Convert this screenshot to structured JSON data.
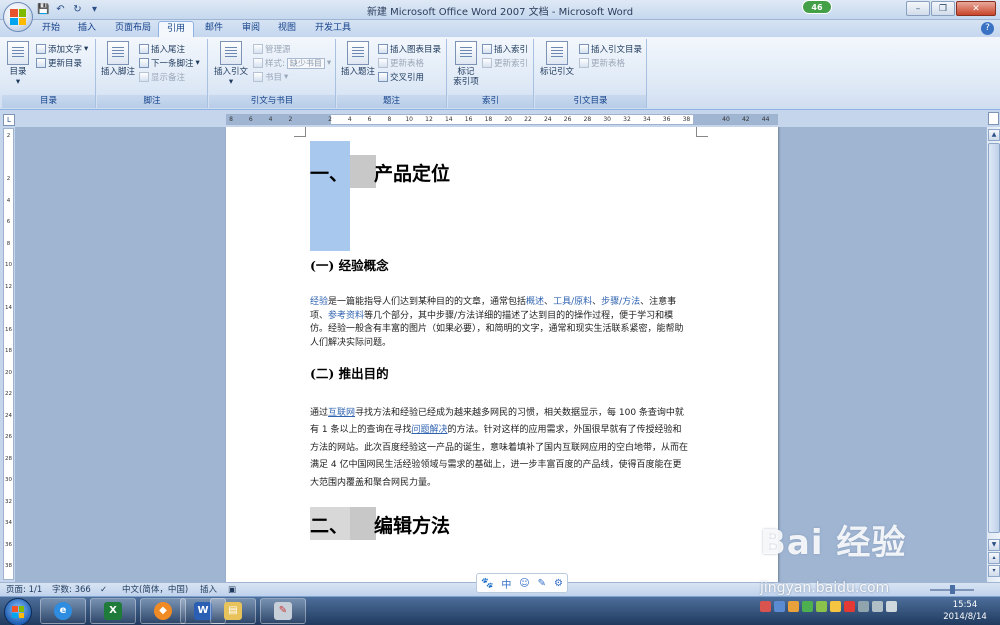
{
  "window": {
    "title": "新建 Microsoft Office Word 2007 文档 - Microsoft Word",
    "badge": "46",
    "minimize": "–",
    "restore": "❐",
    "close": "✕"
  },
  "tabs": [
    "开始",
    "插入",
    "页面布局",
    "引用",
    "邮件",
    "审阅",
    "视图",
    "开发工具"
  ],
  "active_tab": "引用",
  "ribbon": {
    "toc": {
      "big": "目录",
      "add_text": "添加文字",
      "update": "更新目录",
      "group": "目录"
    },
    "footnote": {
      "insert_footnote": "插入脚注",
      "insert_endnote": "插入尾注",
      "next_footnote": "下一条脚注",
      "show_notes": "显示备注",
      "group": "脚注"
    },
    "citation": {
      "insert_citation": "插入引文",
      "manage_sources": "管理源",
      "style_label": "样式:",
      "style_value": "缺少书目",
      "bibliography": "书目",
      "group": "引文与书目"
    },
    "captions": {
      "insert_caption": "插入题注",
      "insert_table_of_figures": "插入图表目录",
      "update_table": "更新表格",
      "cross_reference": "交叉引用",
      "group": "题注"
    },
    "index": {
      "mark_entry_l1": "标记",
      "mark_entry_l2": "索引项",
      "insert_index": "插入索引",
      "update_index": "更新索引",
      "group": "索引"
    },
    "toa": {
      "mark_citation": "标记引文",
      "insert_toa": "插入引文目录",
      "update_table": "更新表格",
      "group": "引文目录"
    }
  },
  "ruler_ticks": [
    "8",
    "6",
    "4",
    "2",
    "",
    "2",
    "4",
    "6",
    "8",
    "10",
    "12",
    "14",
    "16",
    "18",
    "20",
    "22",
    "24",
    "26",
    "28",
    "30",
    "32",
    "34",
    "36",
    "38",
    "",
    "40",
    "42",
    "44"
  ],
  "vruler_ticks": [
    "2",
    "",
    "2",
    "4",
    "6",
    "8",
    "10",
    "12",
    "14",
    "16",
    "18",
    "20",
    "22",
    "24",
    "26",
    "28",
    "30",
    "32",
    "34",
    "36",
    "38"
  ],
  "document": {
    "heading1": {
      "num": "一、",
      "text": "产品定位"
    },
    "sub1": "(一) 经验概念",
    "para1": {
      "link1": "经验",
      "t1": "是一篇能指导人们达到某种目的的文章，通常包括",
      "link2": "概述",
      "s1": "、",
      "link3": "工具/原料",
      "s2": "、",
      "link4": "步骤/方法",
      "t2": "、注意事项、",
      "link5": "参考资料",
      "t3": "等几个部分，其中步骤/方法详细的描述了达到目的的操作过程，便于学习和模仿。经验一般含有丰富的图片（如果必要），和简明的文字，通常和现实生活联系紧密，能帮助人们解决实际问题。"
    },
    "sub2": "(二) 推出目的",
    "para2": {
      "t1": "通过",
      "link1": "互联网",
      "t2": "寻找方法和经验已经成为越来越多网民的习惯，相关数据显示，每 100 条查询中就有 1 条以上的查询在寻找",
      "link2": "问题解决",
      "t3": "的方法。针对这样的应用需求，外国很早就有了传授经验和方法的网站。此次百度经验这一产品的诞生，意味着填补了国内互联网应用的空白地带，从而在满足 4 亿中国网民生活经验领域与需求的基础上，进一步丰富百度的产品线，使得百度能在更大范围内覆盖和聚合网民力量。"
    },
    "heading2": {
      "num": "二、",
      "text": "编辑方法"
    }
  },
  "status": {
    "page": "页面: 1/1",
    "words": "字数: 366",
    "lang": "中文(简体，中国)",
    "mode": "插入"
  },
  "ime": [
    "🐾",
    "中",
    "☺",
    "✎",
    "⚙"
  ],
  "watermark": {
    "brand": "Bai 经验",
    "url": "jingyan.baidu.com"
  },
  "clock": {
    "time": "15:54",
    "date": "2014/8/14"
  },
  "colors": {
    "link": "#2f63b0",
    "selection": "#a8c8ee",
    "ribbon_tab_active": "#f4f8fd"
  }
}
